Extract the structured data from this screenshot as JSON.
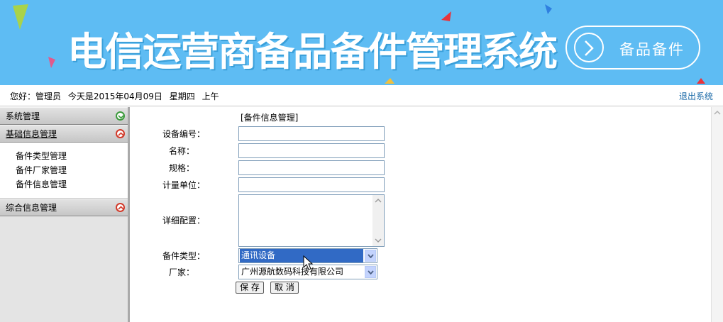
{
  "banner": {
    "title": "电信运营商备品备件管理系统",
    "badge": "备品备件"
  },
  "infobar": {
    "greeting": "您好：管理员",
    "date": "今天是2015年04月09日",
    "weekday": "星期四",
    "period": "上午",
    "logout": "退出系统"
  },
  "sidebar": {
    "sections": [
      {
        "label": "系统管理",
        "expanded": false
      },
      {
        "label": "基础信息管理",
        "expanded": true
      },
      {
        "label": "综合信息管理",
        "expanded": false
      }
    ],
    "items": [
      "备件类型管理",
      "备件厂家管理",
      "备件信息管理"
    ]
  },
  "form": {
    "title": "[备件信息管理]",
    "fields": {
      "device_no": {
        "label": "设备编号：",
        "value": ""
      },
      "name": {
        "label": "名称：",
        "value": ""
      },
      "spec": {
        "label": "规格：",
        "value": ""
      },
      "unit": {
        "label": "计量单位：",
        "value": ""
      },
      "detail": {
        "label": "详细配置：",
        "value": ""
      },
      "type": {
        "label": "备件类型：",
        "value": "通讯设备"
      },
      "vendor": {
        "label": "厂家：",
        "value": "广州源航数码科技有限公司"
      }
    },
    "save": "保 存",
    "cancel": "取 消"
  },
  "colors": {
    "banner_bg": "#5ebcf3",
    "link": "#1b6aa8",
    "select_highlight": "#316ac5"
  }
}
